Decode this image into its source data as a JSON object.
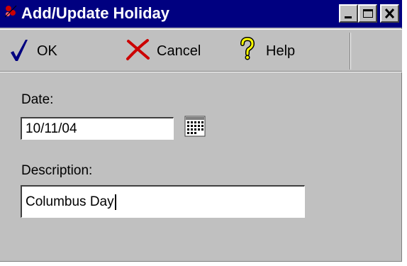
{
  "window": {
    "title": "Add/Update Holiday",
    "controls": {
      "minimize": "minimize-icon",
      "maximize": "maximize-icon",
      "close": "close-icon"
    }
  },
  "toolbar": {
    "ok_label": "OK",
    "cancel_label": "Cancel",
    "help_label": "Help"
  },
  "form": {
    "date_label": "Date:",
    "date_value": "10/11/04",
    "description_label": "Description:",
    "description_value": "Columbus Day"
  },
  "colors": {
    "title_bar": "#000080",
    "window_face": "#c0c0c0",
    "ok_check": "#000080",
    "cancel_x": "#cc0000",
    "help_question": "#ffff00"
  },
  "icons": {
    "app": "app-icon",
    "ok": "checkmark-icon",
    "cancel": "x-icon",
    "help": "question-mark-icon",
    "calendar": "calendar-icon"
  }
}
